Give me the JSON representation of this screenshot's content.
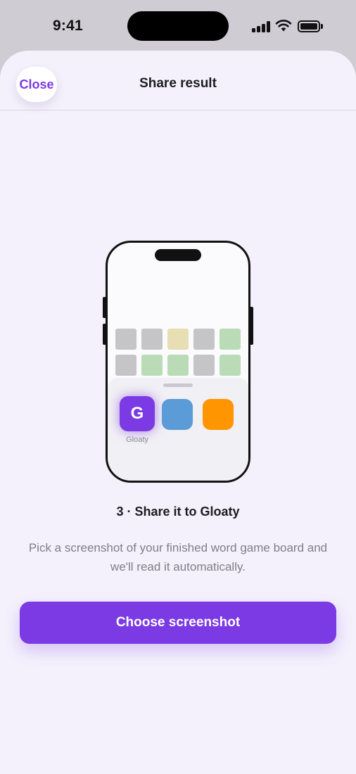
{
  "status_bar": {
    "time": "9:41",
    "icons": [
      "cellular-signal-icon",
      "wifi-icon",
      "battery-icon"
    ]
  },
  "header": {
    "close_label": "Close",
    "title": "Share result"
  },
  "illustration": {
    "tile_rows": [
      [
        "gray",
        "gray",
        "yellow",
        "gray",
        "green"
      ],
      [
        "gray",
        "green",
        "green",
        "gray",
        "green"
      ]
    ],
    "app_icon_letter": "G",
    "app_label": "Gloaty",
    "other_apps": [
      "blue",
      "orange"
    ]
  },
  "step": {
    "title": "3 · Share it to Gloaty",
    "description": "Pick a screenshot of your finished word game board and we'll read it automatically."
  },
  "actions": {
    "choose_label": "Choose screenshot"
  },
  "colors": {
    "accent": "#7b3ae3",
    "sheet_background": "#f4f1fc",
    "tile_gray": "#c5c5c8",
    "tile_yellow": "#e7deb4",
    "tile_green": "#b9dcb7",
    "app_blue": "#5b9bd8",
    "app_orange": "#ff9500"
  }
}
